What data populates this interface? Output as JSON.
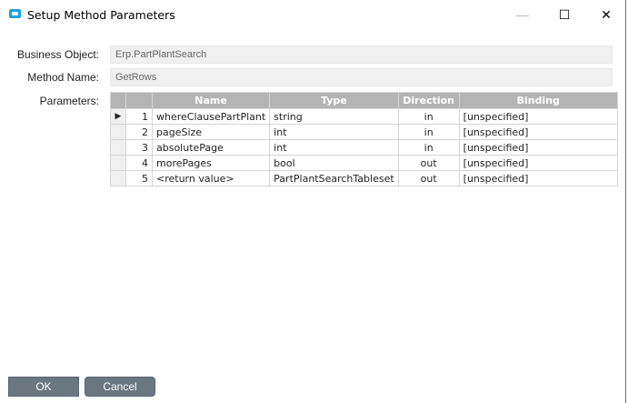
{
  "window": {
    "title": "Setup Method Parameters",
    "minimize": "—",
    "maximize": "☐",
    "close": "✕"
  },
  "form": {
    "business_object_label": "Business Object:",
    "business_object_value": "Erp.PartPlantSearch",
    "method_name_label": "Method Name:",
    "method_name_value": "GetRows",
    "parameters_label": "Parameters:"
  },
  "grid": {
    "columns": [
      "Name",
      "Type",
      "Direction",
      "Binding"
    ],
    "rows": [
      {
        "n": "1",
        "name": "whereClausePartPlant",
        "type": "string",
        "direction": "in",
        "binding": "[unspecified]"
      },
      {
        "n": "2",
        "name": "pageSize",
        "type": "int",
        "direction": "in",
        "binding": "[unspecified]"
      },
      {
        "n": "3",
        "name": "absolutePage",
        "type": "int",
        "direction": "in",
        "binding": "[unspecified]"
      },
      {
        "n": "4",
        "name": "morePages",
        "type": "bool",
        "direction": "out",
        "binding": "[unspecified]"
      },
      {
        "n": "5",
        "name": "<return value>",
        "type": "PartPlantSearchTableset",
        "direction": "out",
        "binding": "[unspecified]"
      }
    ]
  },
  "buttons": {
    "ok": "OK",
    "cancel": "Cancel"
  }
}
